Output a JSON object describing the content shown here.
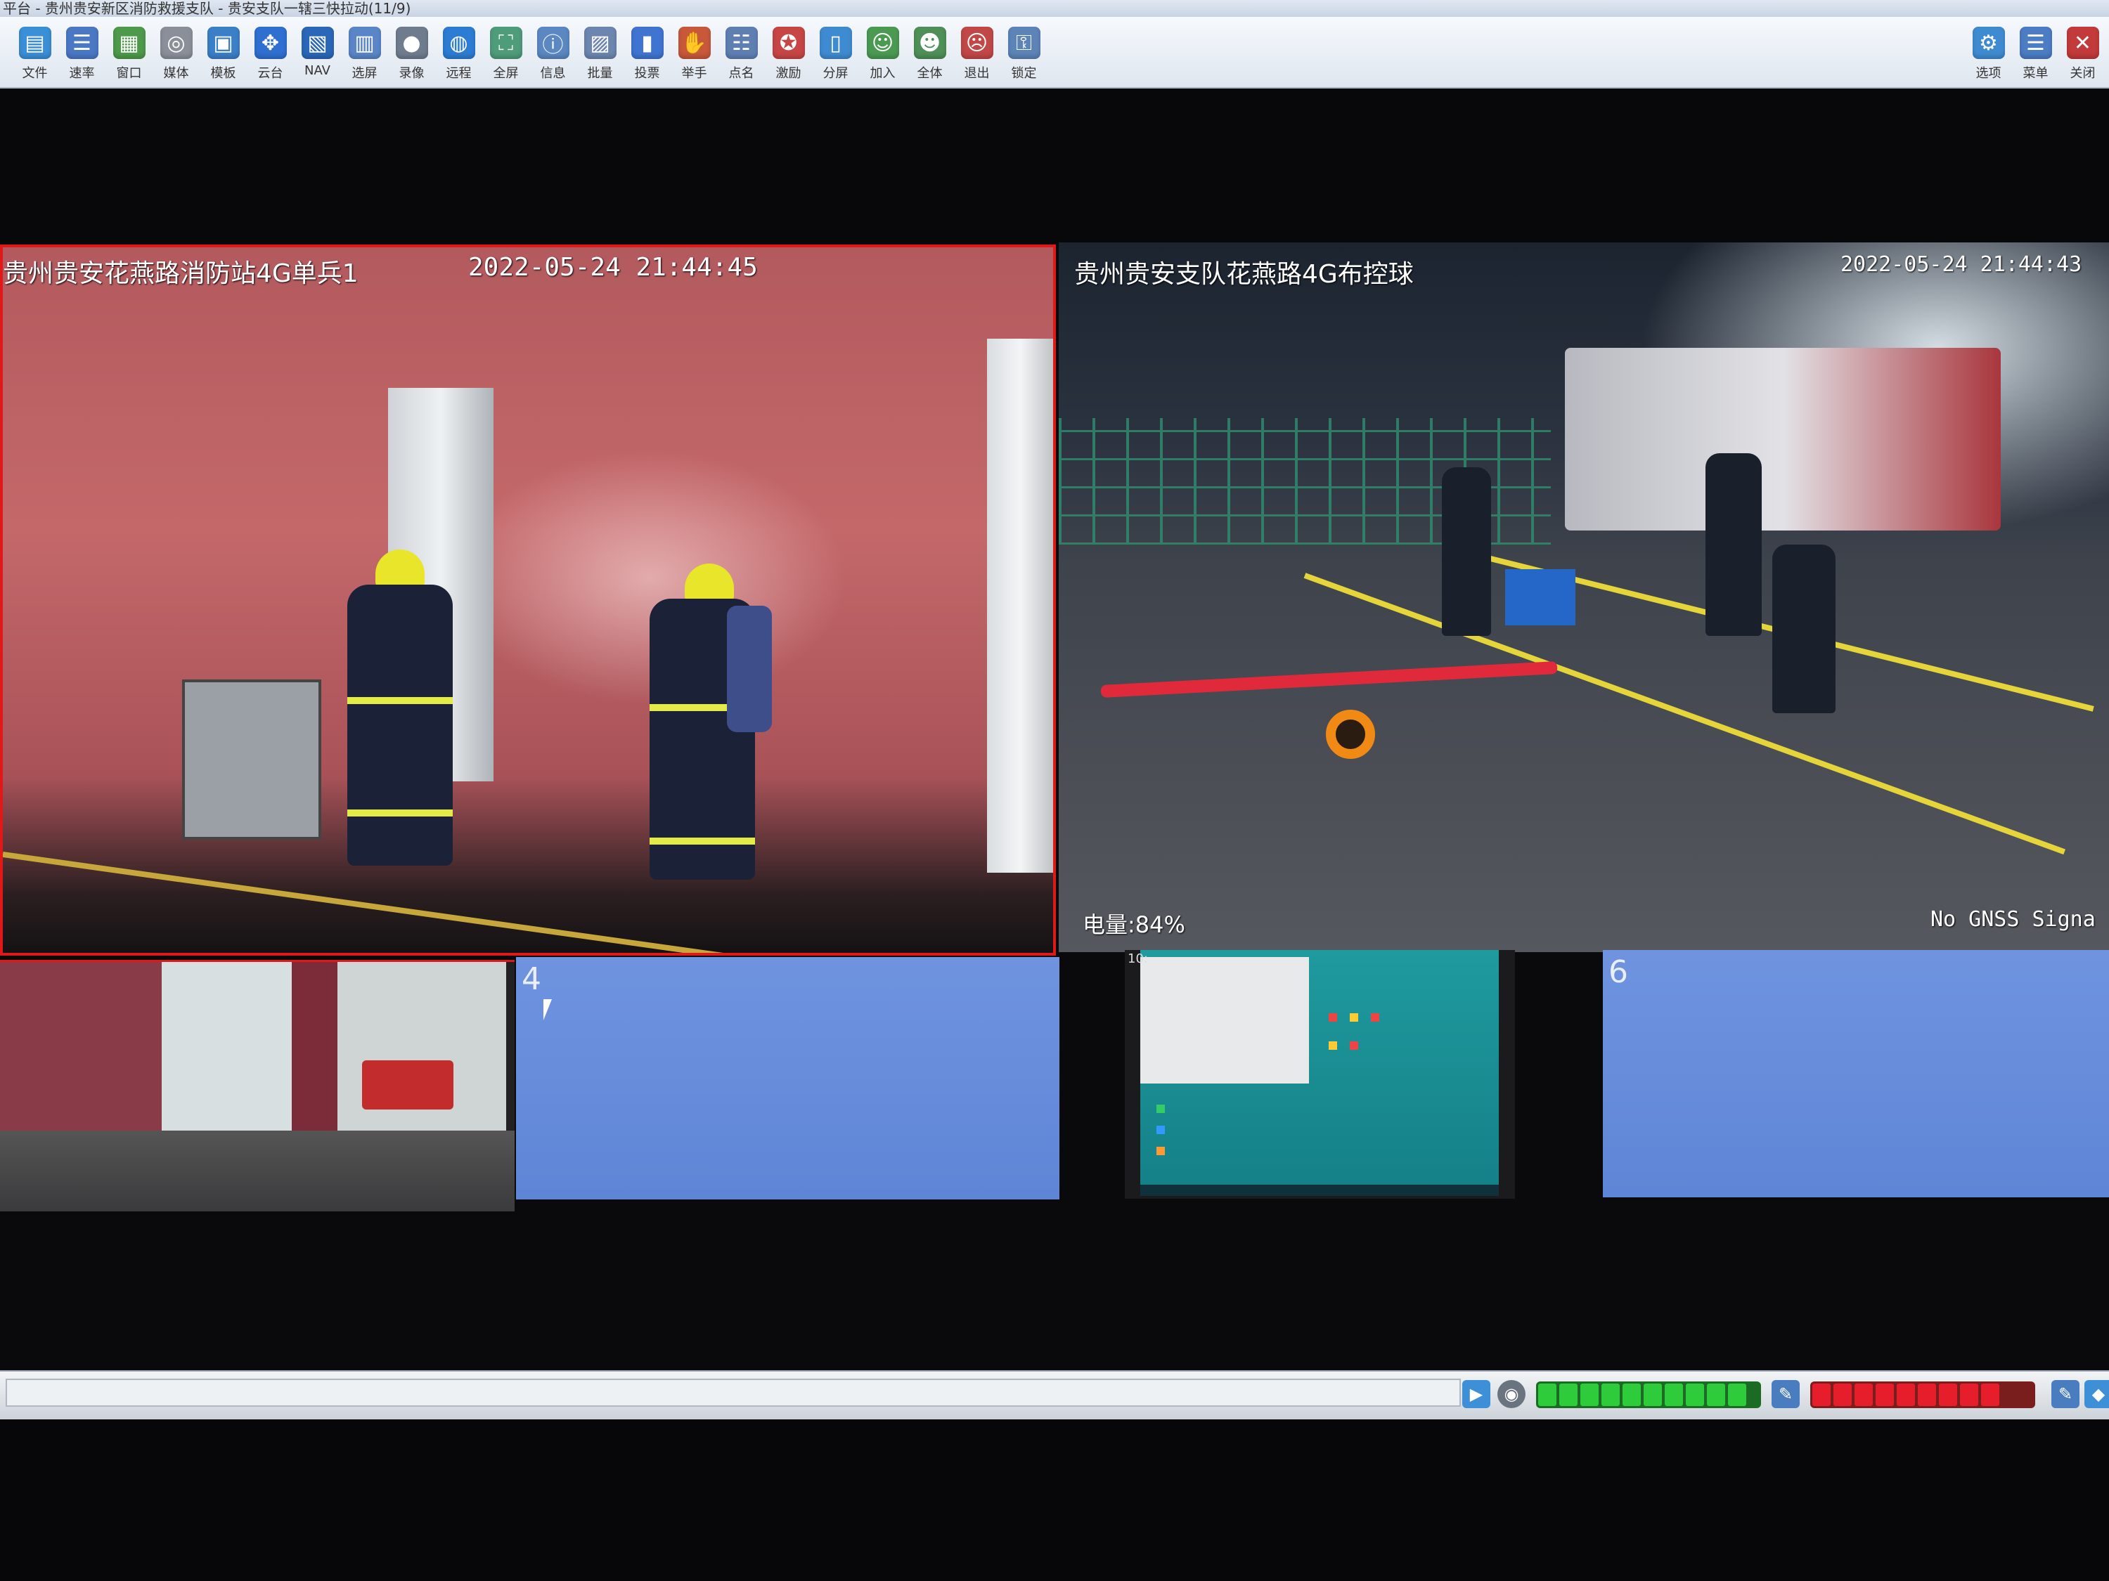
{
  "window": {
    "title": "平台 - 贵州贵安新区消防救援支队 - 贵安支队一辖三快拉动(11/9)"
  },
  "toolbar": {
    "items": [
      {
        "label": "文件",
        "icon": "folder-icon",
        "color": "#3a8fd6"
      },
      {
        "label": "速率",
        "icon": "sliders-icon",
        "color": "#4a78c4"
      },
      {
        "label": "窗口",
        "icon": "windows-icon",
        "color": "#4c9a4a"
      },
      {
        "label": "媒体",
        "icon": "media-icon",
        "color": "#8a8f99"
      },
      {
        "label": "模板",
        "icon": "template-icon",
        "color": "#3b7fc9"
      },
      {
        "label": "云台",
        "icon": "ptz-icon",
        "color": "#2f6fd0"
      },
      {
        "label": "NAV",
        "icon": "nav-icon",
        "color": "#2a67b8"
      },
      {
        "label": "选屏",
        "icon": "screen-select-icon",
        "color": "#5a86c8"
      },
      {
        "label": "录像",
        "icon": "record-icon",
        "color": "#6e7c8e"
      },
      {
        "label": "远程",
        "icon": "globe-icon",
        "color": "#2d7cd3"
      },
      {
        "label": "全屏",
        "icon": "fullscreen-icon",
        "color": "#4e9c7a"
      },
      {
        "label": "信息",
        "icon": "info-icon",
        "color": "#5b88c2"
      },
      {
        "label": "批量",
        "icon": "batch-icon",
        "color": "#6c86b0"
      },
      {
        "label": "投票",
        "icon": "vote-icon",
        "color": "#3f74d1"
      },
      {
        "label": "举手",
        "icon": "hand-icon",
        "color": "#c8583a"
      },
      {
        "label": "点名",
        "icon": "rollcall-icon",
        "color": "#5f7fb3"
      },
      {
        "label": "激励",
        "icon": "incentive-icon",
        "color": "#c74545"
      },
      {
        "label": "分屏",
        "icon": "split-icon",
        "color": "#3f8bd1"
      },
      {
        "label": "加入",
        "icon": "user-add-icon",
        "color": "#4a9a52"
      },
      {
        "label": "全体",
        "icon": "group-icon",
        "color": "#4f8f58"
      },
      {
        "label": "退出",
        "icon": "user-exit-icon",
        "color": "#c24747"
      },
      {
        "label": "锁定",
        "icon": "lock-icon",
        "color": "#5c84b8"
      }
    ],
    "right_items": [
      {
        "label": "选项",
        "icon": "gear-icon",
        "color": "#3f8bd1"
      },
      {
        "label": "菜单",
        "icon": "menu-icon",
        "color": "#4b7cc4"
      },
      {
        "label": "关闭",
        "icon": "close-icon",
        "color": "#c23a3a"
      }
    ]
  },
  "tiles": {
    "tile1": {
      "caption": "贵州贵安花燕路消防站4G单兵1",
      "timestamp": "2022-05-24 21:44:45"
    },
    "tile2": {
      "caption": "贵州贵安支队花燕路4G布控球",
      "timestamp": "2022-05-24 21:44:43",
      "battery": "电量:84%",
      "gnss": "No GNSS Signa"
    },
    "tile4": {
      "number": "4"
    },
    "tile5": {
      "clock": "10:"
    },
    "tile6": {
      "number": "6"
    }
  },
  "statusbar": {
    "green_meter_segments": 10,
    "red_meter_segments": 9,
    "colors": {
      "green": "#2ecc3a",
      "red": "#e61e2b",
      "accent_red": "#e01818"
    }
  }
}
